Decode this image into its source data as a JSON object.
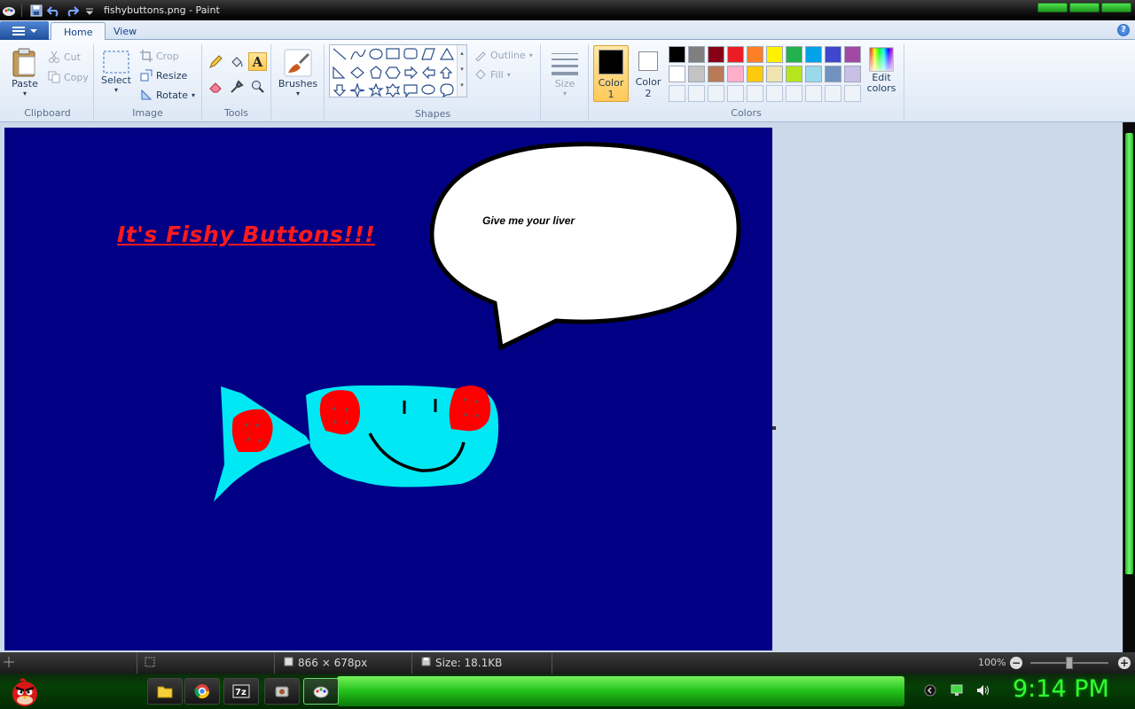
{
  "window": {
    "title": "fishybuttons.png - Paint"
  },
  "tabs": [
    {
      "label": "Home"
    },
    {
      "label": "View"
    }
  ],
  "clipboard": {
    "paste": "Paste",
    "cut": "Cut",
    "copy": "Copy",
    "label": "Clipboard"
  },
  "image": {
    "select": "Select",
    "crop": "Crop",
    "resize": "Resize",
    "rotate": "Rotate",
    "label": "Image"
  },
  "tools": {
    "label": "Tools"
  },
  "brushes": {
    "label": "Brushes"
  },
  "shapes": {
    "label": "Shapes",
    "outline": "Outline",
    "fill": "Fill"
  },
  "size": {
    "label": "Size"
  },
  "colors": {
    "color1_label": "Color",
    "color1_num": "1",
    "color2_label": "Color",
    "color2_num": "2",
    "edit_label1": "Edit",
    "edit_label2": "colors",
    "label": "Colors",
    "color1": "#000000",
    "color2": "#ffffff",
    "palette_row1": [
      "#000000",
      "#7f7f7f",
      "#880015",
      "#ed1c24",
      "#ff7f27",
      "#fff200",
      "#22b14c",
      "#00a2e8",
      "#3f48cc",
      "#a349a4"
    ],
    "palette_row2": [
      "#ffffff",
      "#c3c3c3",
      "#b97a57",
      "#ffaec9",
      "#ffc90e",
      "#efe4b0",
      "#b5e61d",
      "#99d9ea",
      "#7092be",
      "#c8bfe7"
    ]
  },
  "canvas": {
    "heading": "It's Fishy Buttons!!!",
    "bubble_text": "Give me your liver",
    "background": "#010085"
  },
  "status": {
    "dimensions": "866 × 678px",
    "size": "Size: 18.1KB",
    "zoom": "100%"
  },
  "taskbar": {
    "clock": "9:14 PM"
  }
}
